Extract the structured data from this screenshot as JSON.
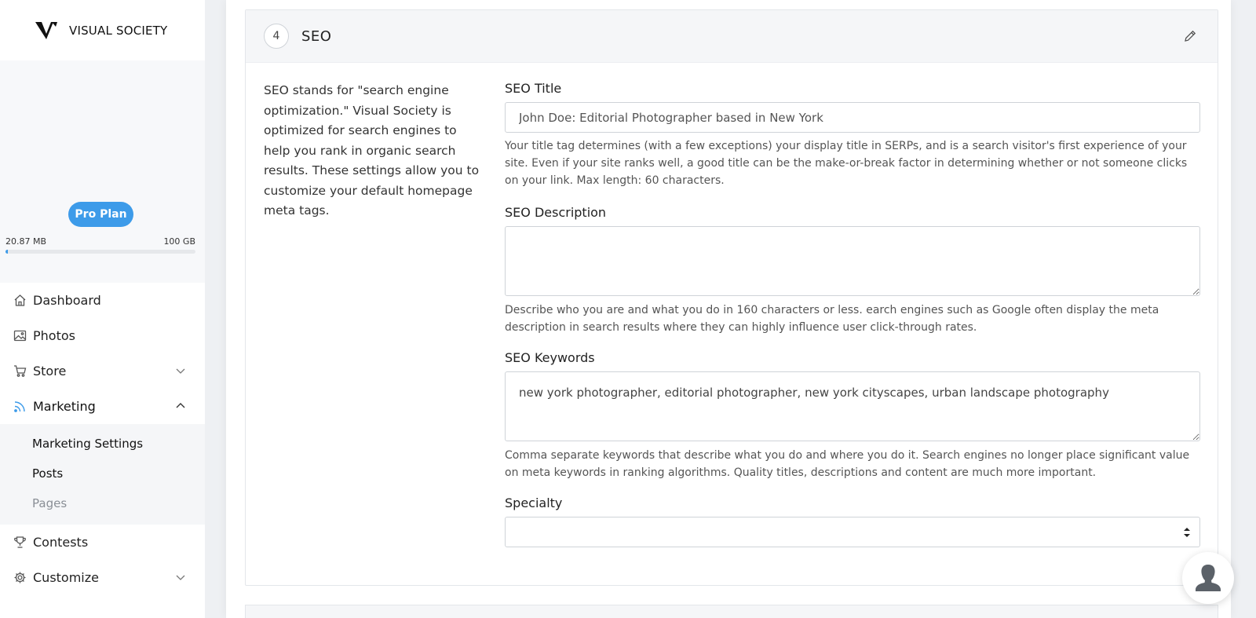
{
  "brand": {
    "name": "VISUAL SOCIETY"
  },
  "account": {
    "plan_label": "Pro Plan",
    "storage_used": "20.87 MB",
    "storage_total": "100 GB",
    "storage_fraction": 0.002,
    "accent_color": "#3d9be9"
  },
  "sidebar": {
    "items": [
      {
        "label": "Dashboard",
        "icon": "home-icon"
      },
      {
        "label": "Photos",
        "icon": "image-icon"
      },
      {
        "label": "Store",
        "icon": "cart-icon",
        "chevron": "down"
      },
      {
        "label": "Marketing",
        "icon": "rss-icon",
        "chevron": "up",
        "active": true
      },
      {
        "label": "Contests",
        "icon": "trophy-icon"
      },
      {
        "label": "Customize",
        "icon": "gear-icon",
        "chevron": "down"
      }
    ],
    "marketing_sub": [
      {
        "label": "Marketing Settings"
      },
      {
        "label": "Posts"
      },
      {
        "label": "Pages",
        "muted": true
      }
    ]
  },
  "seo_section": {
    "step": "4",
    "title": "SEO",
    "intro": "SEO stands for \"search engine optimization.\" Visual Society is optimized for search engines to help you rank in organic search results. These settings allow you to customize your default homepage meta tags.",
    "fields": {
      "title": {
        "label": "SEO Title",
        "value": "John Doe: Editorial Photographer based in New York",
        "help": "Your title tag determines (with a few exceptions) your display title in SERPs, and is a search visitor's first experience of your site. Even if your site ranks well, a good title can be the make-or-break factor in determining whether or not someone clicks on your link. Max length: 60 characters."
      },
      "description": {
        "label": "SEO Description",
        "value": "",
        "help": "Describe who you are and what you do in 160 characters or less. earch engines such as Google often display the meta description in search results where they can highly influence user click-through rates."
      },
      "keywords": {
        "label": "SEO Keywords",
        "value": "new york photographer, editorial photographer, new york cityscapes, urban landscape photography",
        "help": "Comma separate keywords that describe what you do and where you do it. Search engines no longer place significant value on meta keywords in ranking algorithms. Quality titles, descriptions and content are much more important."
      },
      "specialty": {
        "label": "Specialty",
        "value": ""
      }
    }
  }
}
